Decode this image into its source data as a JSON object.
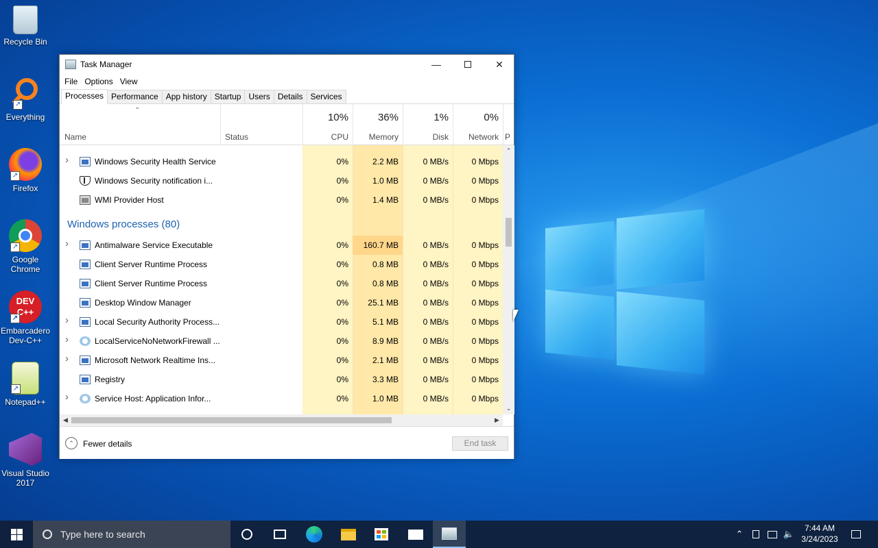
{
  "desktop": {
    "icons": [
      {
        "label": "Recycle Bin",
        "icon": "recycle-bin-icon"
      },
      {
        "label": "Everything",
        "icon": "everything-search-icon"
      },
      {
        "label": "Firefox",
        "icon": "firefox-icon"
      },
      {
        "label": "Google Chrome",
        "icon": "chrome-icon"
      },
      {
        "label": "Embarcadero Dev-C++",
        "icon": "dev-cpp-icon"
      },
      {
        "label": "Notepad++",
        "icon": "notepad-plus-plus-icon"
      },
      {
        "label": "Visual Studio 2017",
        "icon": "visual-studio-icon"
      }
    ]
  },
  "window": {
    "title": "Task Manager",
    "menu": [
      "File",
      "Options",
      "View"
    ],
    "tabs": [
      "Processes",
      "Performance",
      "App history",
      "Startup",
      "Users",
      "Details",
      "Services"
    ],
    "active_tab": "Processes"
  },
  "columns": {
    "name": "Name",
    "status": "Status",
    "cpu": {
      "pct": "10%",
      "label": "CPU"
    },
    "memory": {
      "pct": "36%",
      "label": "Memory"
    },
    "disk": {
      "pct": "1%",
      "label": "Disk"
    },
    "network": {
      "pct": "0%",
      "label": "Network"
    },
    "power": "P"
  },
  "app_rows": [
    {
      "name": "Windows Security Health Service",
      "cpu": "0%",
      "memory": "2.2 MB",
      "disk": "0 MB/s",
      "network": "0 Mbps",
      "expandable": true,
      "icon": "service-window-icon"
    },
    {
      "name": "Windows Security notification i...",
      "cpu": "0%",
      "memory": "1.0 MB",
      "disk": "0 MB/s",
      "network": "0 Mbps",
      "expandable": false,
      "icon": "shield-icon"
    },
    {
      "name": "WMI Provider Host",
      "cpu": "0%",
      "memory": "1.4 MB",
      "disk": "0 MB/s",
      "network": "0 Mbps",
      "expandable": false,
      "icon": "wmi-icon"
    }
  ],
  "group": {
    "label": "Windows processes (80)"
  },
  "windows_rows": [
    {
      "name": "Antimalware Service Executable",
      "cpu": "0%",
      "memory": "160.7 MB",
      "disk": "0 MB/s",
      "network": "0 Mbps",
      "expandable": true,
      "icon": "service-window-icon"
    },
    {
      "name": "Client Server Runtime Process",
      "cpu": "0%",
      "memory": "0.8 MB",
      "disk": "0 MB/s",
      "network": "0 Mbps",
      "expandable": false,
      "icon": "service-window-icon"
    },
    {
      "name": "Client Server Runtime Process",
      "cpu": "0%",
      "memory": "0.8 MB",
      "disk": "0 MB/s",
      "network": "0 Mbps",
      "expandable": false,
      "icon": "service-window-icon"
    },
    {
      "name": "Desktop Window Manager",
      "cpu": "0%",
      "memory": "25.1 MB",
      "disk": "0 MB/s",
      "network": "0 Mbps",
      "expandable": false,
      "icon": "service-window-icon"
    },
    {
      "name": "Local Security Authority Process...",
      "cpu": "0%",
      "memory": "5.1 MB",
      "disk": "0 MB/s",
      "network": "0 Mbps",
      "expandable": true,
      "icon": "service-window-icon"
    },
    {
      "name": "LocalServiceNoNetworkFirewall ...",
      "cpu": "0%",
      "memory": "8.9 MB",
      "disk": "0 MB/s",
      "network": "0 Mbps",
      "expandable": true,
      "icon": "gear-icon"
    },
    {
      "name": "Microsoft Network Realtime Ins...",
      "cpu": "0%",
      "memory": "2.1 MB",
      "disk": "0 MB/s",
      "network": "0 Mbps",
      "expandable": true,
      "icon": "service-window-icon"
    },
    {
      "name": "Registry",
      "cpu": "0%",
      "memory": "3.3 MB",
      "disk": "0 MB/s",
      "network": "0 Mbps",
      "expandable": false,
      "icon": "service-window-icon"
    },
    {
      "name": "Service Host: Application Infor...",
      "cpu": "0%",
      "memory": "1.0 MB",
      "disk": "0 MB/s",
      "network": "0 Mbps",
      "expandable": true,
      "icon": "gear-icon"
    }
  ],
  "footer": {
    "fewer_details": "Fewer details",
    "end_task": "End task"
  },
  "taskbar": {
    "search_placeholder": "Type here to search",
    "time": "7:44 AM",
    "date": "3/24/2023"
  },
  "colors": {
    "cpu_bg": "#fff4c4",
    "memory_bg": "#ffe8a8",
    "memory_hot": "#ffd68a",
    "group_text": "#1e62b0"
  }
}
